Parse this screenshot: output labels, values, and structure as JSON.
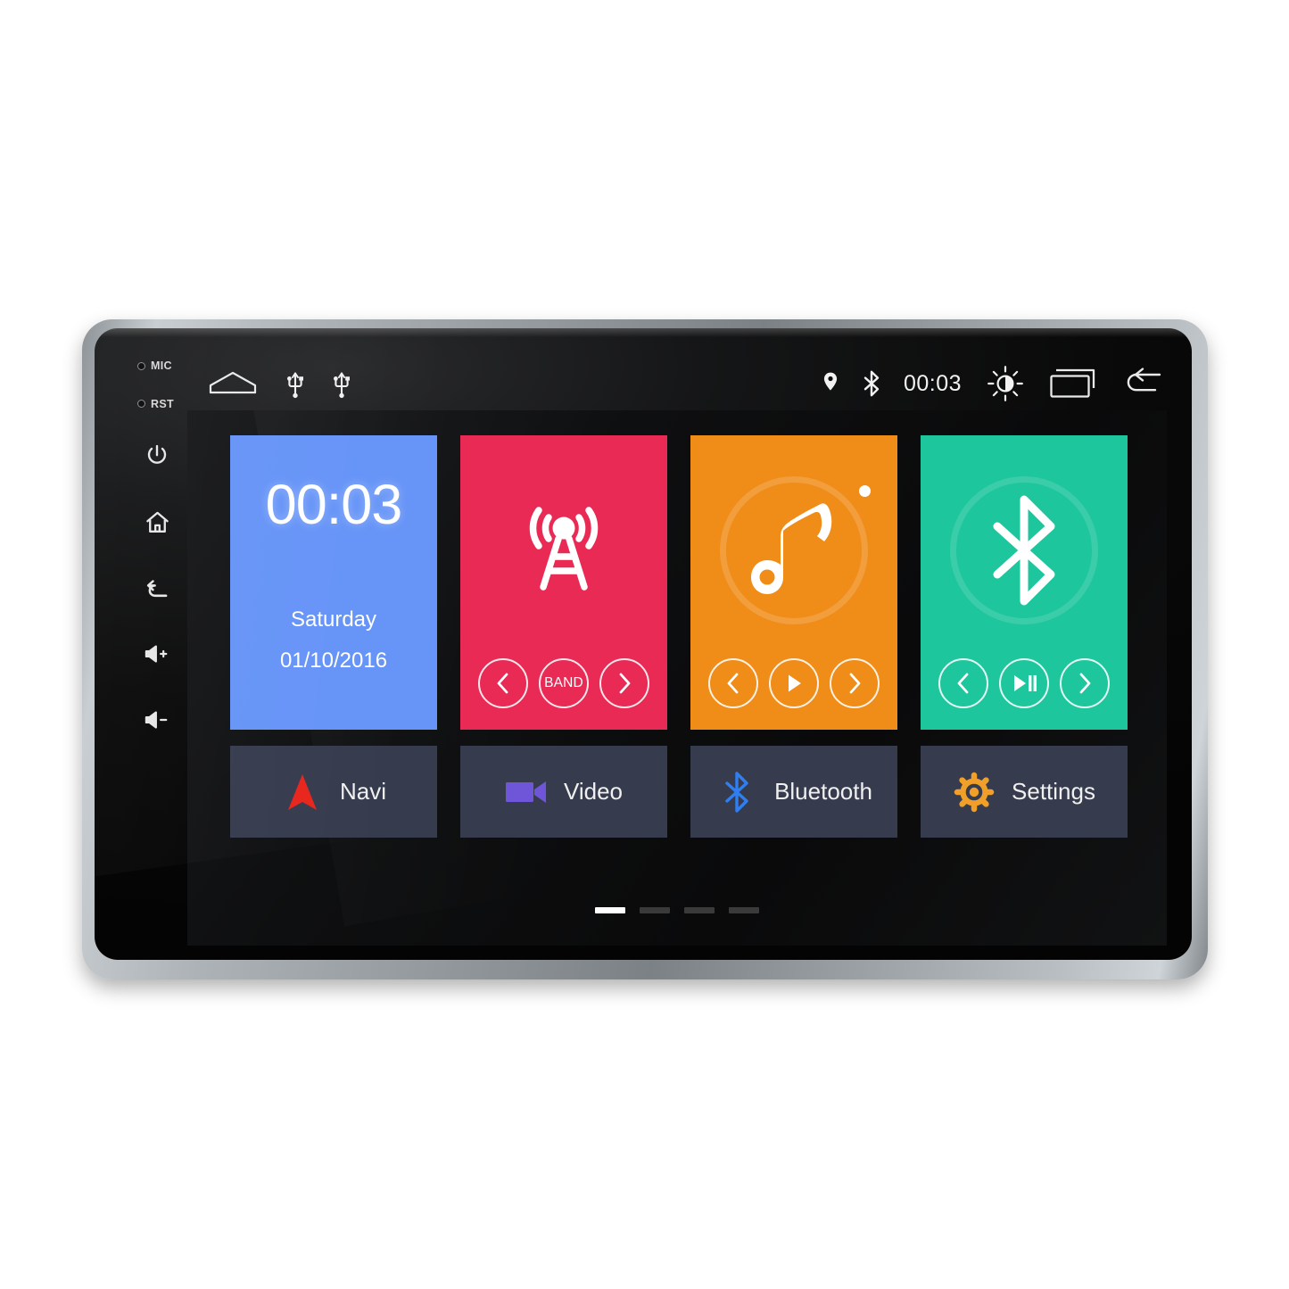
{
  "device": {
    "bezel_labels": [
      {
        "name": "mic",
        "text": "MIC"
      },
      {
        "name": "reset",
        "text": "RST"
      }
    ],
    "hardware_buttons": [
      {
        "name": "power-button",
        "icon": "power-icon"
      },
      {
        "name": "home-button",
        "icon": "home-icon"
      },
      {
        "name": "back-button",
        "icon": "back-arrow-icon"
      },
      {
        "name": "volume-up-button",
        "icon": "volume-up-icon"
      },
      {
        "name": "volume-down-button",
        "icon": "volume-down-icon"
      }
    ]
  },
  "statusbar": {
    "left_icons": [
      {
        "name": "home-icon",
        "label": "Home"
      },
      {
        "name": "usb-icon-1",
        "label": "USB 1"
      },
      {
        "name": "usb-icon-2",
        "label": "USB 2"
      }
    ],
    "gps_icon": "location-pin-icon",
    "bluetooth_icon": "bluetooth-icon",
    "time": "00:03",
    "brightness_icon": "brightness-icon",
    "recents_icon": "recent-apps-icon",
    "back_icon": "back-arrow-icon"
  },
  "home": {
    "tiles": [
      {
        "name": "clock-tile",
        "type": "clock",
        "color": "#6694f7",
        "time": "00:03",
        "weekday": "Saturday",
        "date": "01/10/2016"
      },
      {
        "name": "radio-tile",
        "type": "radio",
        "color": "#e82a55",
        "icon": "radio-tower-icon",
        "controls": [
          {
            "name": "radio-prev-button",
            "icon": "chevron-left-icon",
            "label": ""
          },
          {
            "name": "radio-band-button",
            "icon": "band-icon",
            "label": "BAND"
          },
          {
            "name": "radio-next-button",
            "icon": "chevron-right-icon",
            "label": ""
          }
        ]
      },
      {
        "name": "music-tile",
        "type": "music",
        "color": "#f08c18",
        "icon": "music-note-icon",
        "controls": [
          {
            "name": "music-prev-button",
            "icon": "chevron-left-icon",
            "label": ""
          },
          {
            "name": "music-play-button",
            "icon": "play-icon",
            "label": ""
          },
          {
            "name": "music-next-button",
            "icon": "chevron-right-icon",
            "label": ""
          }
        ]
      },
      {
        "name": "bluetooth-audio-tile",
        "type": "bluetooth",
        "color": "#1ec69e",
        "icon": "bluetooth-icon",
        "controls": [
          {
            "name": "bt-prev-button",
            "icon": "chevron-left-icon",
            "label": ""
          },
          {
            "name": "bt-play-pause-button",
            "icon": "play-pause-icon",
            "label": ""
          },
          {
            "name": "bt-next-button",
            "icon": "chevron-right-icon",
            "label": ""
          }
        ]
      }
    ],
    "shortcuts": [
      {
        "name": "navi-shortcut",
        "label": "Navi",
        "icon": "navigation-arrow-icon",
        "color": "#e8261d"
      },
      {
        "name": "video-shortcut",
        "label": "Video",
        "icon": "video-camera-icon",
        "color": "#6f56d8"
      },
      {
        "name": "bluetooth-shortcut",
        "label": "Bluetooth",
        "icon": "bluetooth-icon",
        "color": "#2f7ff0"
      },
      {
        "name": "settings-shortcut",
        "label": "Settings",
        "icon": "gear-icon",
        "color": "#f0a028"
      }
    ],
    "pager": {
      "pages": 4,
      "active": 1
    }
  }
}
